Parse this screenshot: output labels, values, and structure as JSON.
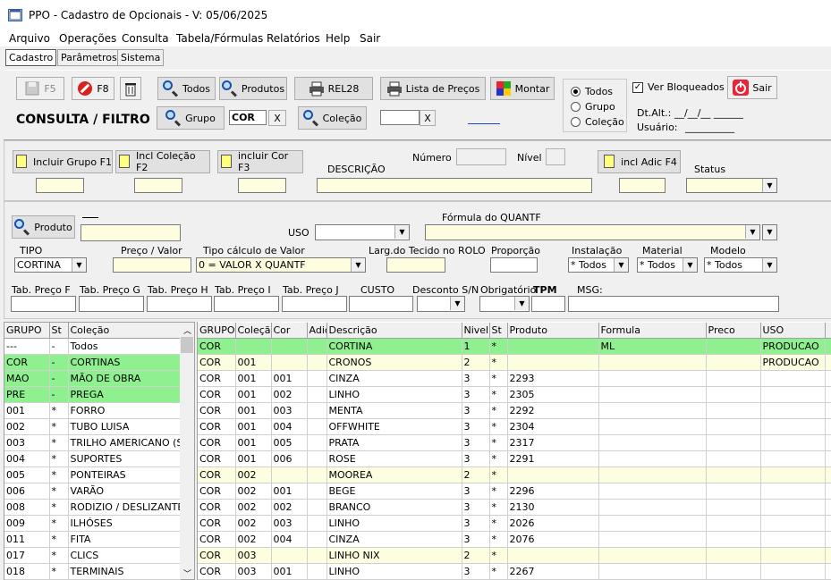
{
  "window": {
    "title": "PPO - Cadastro de Opcionais - V: 05/06/2025"
  },
  "menu": [
    "Arquivo",
    "Operações",
    "Consulta",
    "Tabela/Fórmulas",
    "Relatórios",
    "Help",
    "Sair"
  ],
  "tabs": [
    "Cadastro",
    "Parâmetros",
    "Sistema"
  ],
  "toolbar": {
    "f5": "F5",
    "f8": "F8",
    "todos": "Todos",
    "produtos": "Produtos",
    "rel28": "REL28",
    "lista_precos": "Lista de Preços",
    "montar": "Montar",
    "grupo": "Grupo",
    "colecao": "Coleção",
    "consulta_filtro": "CONSULTA / FILTRO",
    "grupo_value": "COR",
    "clear": "X",
    "sair": "Sair"
  },
  "filter_radios": {
    "options": [
      "Todos",
      "Grupo",
      "Coleção"
    ],
    "selected": "Todos"
  },
  "ver_bloqueados": {
    "label": "Ver Bloqueados",
    "checked": true
  },
  "dt_alt": {
    "label": "Dt.Alt.:",
    "value": "__/__/__  ______"
  },
  "usuario": {
    "label": "Usuário:",
    "value": "__________"
  },
  "include": {
    "grupo": "Incluir Grupo F1",
    "colecao": "Incl Coleção F2",
    "cor": "incluir Cor F3",
    "adic": "incl Adic F4",
    "descricao": "DESCRIÇÃO",
    "numero": "Número",
    "nivel": "Nível",
    "status": "Status"
  },
  "produto": {
    "button": "Produto",
    "uso": "USO",
    "formula": "Fórmula do QUANTF",
    "tipo": "TIPO",
    "tipo_value": "CORTINA",
    "preco_valor": "Preço / Valor",
    "tipo_calculo": "Tipo cálculo de Valor",
    "tipo_calculo_value": "0 = VALOR X QUANTF",
    "larg_tecido": "Larg.do Tecido no ROLO",
    "proporcao": "Proporção",
    "instalacao": "Instalação",
    "instalacao_value": "* Todos",
    "material": "Material",
    "material_value": "* Todos",
    "modelo": "Modelo",
    "modelo_value": "* Todos",
    "tab_f": "Tab. Preço F",
    "tab_g": "Tab. Preço G",
    "tab_h": "Tab. Preço H",
    "tab_i": "Tab. Preço I",
    "tab_j": "Tab. Preço J",
    "custo": "CUSTO",
    "desconto": "Desconto S/N",
    "obrigatorio": "Obrigatório",
    "tpm": "TPM",
    "msg": "MSG:"
  },
  "left_grid": {
    "headers": [
      "GRUPO",
      "St",
      "Coleção"
    ],
    "rows": [
      {
        "c": [
          "---",
          "-",
          "Todos"
        ],
        "s": "w"
      },
      {
        "c": [
          "COR",
          "-",
          "CORTINAS"
        ],
        "s": "g"
      },
      {
        "c": [
          "MAO",
          "-",
          "MÃO DE OBRA"
        ],
        "s": "g"
      },
      {
        "c": [
          "PRE",
          "-",
          "PREGA"
        ],
        "s": "g"
      },
      {
        "c": [
          "001",
          "*",
          "FORRO"
        ],
        "s": "w"
      },
      {
        "c": [
          "002",
          "*",
          "TUBO LUISA"
        ],
        "s": "w"
      },
      {
        "c": [
          "003",
          "*",
          "TRILHO AMERICANO (SI"
        ],
        "s": "w"
      },
      {
        "c": [
          "004",
          "*",
          "SUPORTES"
        ],
        "s": "w"
      },
      {
        "c": [
          "005",
          "*",
          "PONTEIRAS"
        ],
        "s": "w"
      },
      {
        "c": [
          "006",
          "*",
          "VARÃO"
        ],
        "s": "w"
      },
      {
        "c": [
          "008",
          "*",
          "RODIZIO / DESLIZANTE"
        ],
        "s": "w"
      },
      {
        "c": [
          "009",
          "*",
          "ILHÓSES"
        ],
        "s": "w"
      },
      {
        "c": [
          "011",
          "*",
          "FITA"
        ],
        "s": "w"
      },
      {
        "c": [
          "017",
          "*",
          "CLICS"
        ],
        "s": "w"
      },
      {
        "c": [
          "018",
          "*",
          "TERMINAIS"
        ],
        "s": "w"
      }
    ]
  },
  "right_grid": {
    "headers": [
      "GRUPO",
      "Coleção",
      "Cor",
      "Adic",
      "Descrição",
      "Nivel",
      "St",
      "Produto",
      "Formula",
      "Preco",
      "USO",
      ""
    ],
    "rows": [
      {
        "c": [
          "COR",
          "",
          "",
          "",
          "CORTINA",
          "1",
          "*",
          "",
          "ML",
          "",
          "PRODUCAO",
          ""
        ],
        "s": "g"
      },
      {
        "c": [
          "COR",
          "001",
          "",
          "",
          "CRONOS",
          "2",
          "*",
          "",
          "",
          "",
          "PRODUCAO",
          ""
        ],
        "s": "y"
      },
      {
        "c": [
          "COR",
          "001",
          "001",
          "",
          "CINZA",
          "3",
          "*",
          "2293",
          "",
          "",
          "",
          ""
        ],
        "s": "w"
      },
      {
        "c": [
          "COR",
          "001",
          "002",
          "",
          "LINHO",
          "3",
          "*",
          "2305",
          "",
          "",
          "",
          ""
        ],
        "s": "w"
      },
      {
        "c": [
          "COR",
          "001",
          "003",
          "",
          "MENTA",
          "3",
          "*",
          "2292",
          "",
          "",
          "",
          ""
        ],
        "s": "w"
      },
      {
        "c": [
          "COR",
          "001",
          "004",
          "",
          "OFFWHITE",
          "3",
          "*",
          "2304",
          "",
          "",
          "",
          ""
        ],
        "s": "w"
      },
      {
        "c": [
          "COR",
          "001",
          "005",
          "",
          "PRATA",
          "3",
          "*",
          "2317",
          "",
          "",
          "",
          ""
        ],
        "s": "w"
      },
      {
        "c": [
          "COR",
          "001",
          "006",
          "",
          "ROSE",
          "3",
          "*",
          "2291",
          "",
          "",
          "",
          ""
        ],
        "s": "w"
      },
      {
        "c": [
          "COR",
          "002",
          "",
          "",
          "MOOREA",
          "2",
          "*",
          "",
          "",
          "",
          "",
          ""
        ],
        "s": "y"
      },
      {
        "c": [
          "COR",
          "002",
          "001",
          "",
          "BEGE",
          "3",
          "*",
          "2296",
          "",
          "",
          "",
          ""
        ],
        "s": "w"
      },
      {
        "c": [
          "COR",
          "002",
          "002",
          "",
          "BRANCO",
          "3",
          "*",
          "2130",
          "",
          "",
          "",
          ""
        ],
        "s": "w"
      },
      {
        "c": [
          "COR",
          "002",
          "003",
          "",
          "LINHO",
          "3",
          "*",
          "2026",
          "",
          "",
          "",
          ""
        ],
        "s": "w"
      },
      {
        "c": [
          "COR",
          "002",
          "004",
          "",
          "CINZA",
          "3",
          "*",
          "2076",
          "",
          "",
          "",
          ""
        ],
        "s": "w"
      },
      {
        "c": [
          "COR",
          "003",
          "",
          "",
          "LINHO NIX",
          "2",
          "*",
          "",
          "",
          "",
          "",
          ""
        ],
        "s": "y"
      },
      {
        "c": [
          "COR",
          "003",
          "001",
          "",
          "LINHO",
          "3",
          "*",
          "2267",
          "",
          "",
          "",
          ""
        ],
        "s": "w"
      }
    ]
  }
}
